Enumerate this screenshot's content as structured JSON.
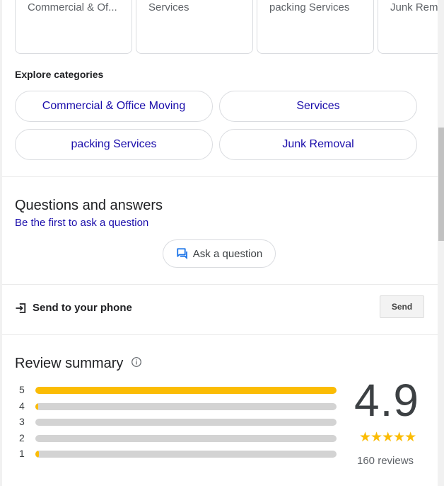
{
  "top_cards": [
    {
      "label": "Commercial & Of..."
    },
    {
      "label": "Services"
    },
    {
      "label": "packing Services"
    },
    {
      "label": "Junk Rem"
    }
  ],
  "explore": {
    "title": "Explore categories",
    "chips": [
      {
        "label": "Commercial & Office Moving"
      },
      {
        "label": "Services"
      },
      {
        "label": "packing Services"
      },
      {
        "label": "Junk Removal"
      }
    ]
  },
  "qa": {
    "title": "Questions and answers",
    "link": "Be the first to ask a question",
    "ask_button": "Ask a question"
  },
  "send": {
    "title": "Send to your phone",
    "button": "Send"
  },
  "review_summary": {
    "title": "Review summary",
    "rating": "4.9",
    "stars": "★★★★★",
    "count": "160 reviews",
    "distribution": [
      {
        "stars": "5",
        "fraction": 1.0
      },
      {
        "stars": "4",
        "fraction": 0.006
      },
      {
        "stars": "3",
        "fraction": 0.0
      },
      {
        "stars": "2",
        "fraction": 0.0
      },
      {
        "stars": "1",
        "fraction": 0.012
      }
    ]
  },
  "colors": {
    "link": "#1a0dab",
    "star": "#fbbc04",
    "bar_track": "#d3d3d3",
    "accent_icon": "#1a73e8"
  }
}
